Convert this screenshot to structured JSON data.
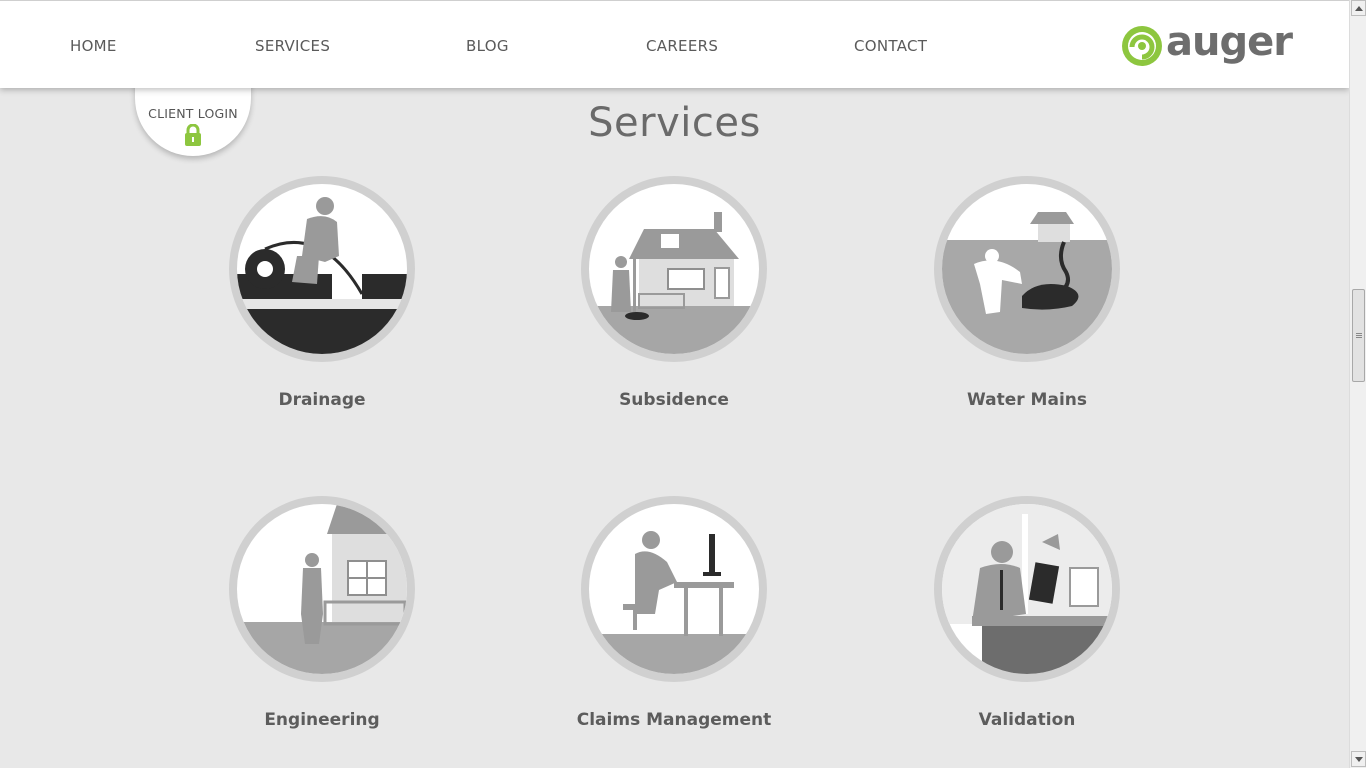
{
  "nav": {
    "items": [
      {
        "label": "HOME"
      },
      {
        "label": "SERVICES"
      },
      {
        "label": "BLOG"
      },
      {
        "label": "CAREERS"
      },
      {
        "label": "CONTACT"
      }
    ]
  },
  "logo": {
    "text": "auger",
    "color": "#8dc63f",
    "icon": "swirl-logo-icon"
  },
  "client_login": {
    "label": "CLIENT LOGIN",
    "icon": "lock-icon",
    "icon_color": "#8dc63f"
  },
  "page_title": "Services",
  "services": [
    {
      "label": "Drainage",
      "icon": "drainage-illustration"
    },
    {
      "label": "Subsidence",
      "icon": "subsidence-illustration"
    },
    {
      "label": "Water Mains",
      "icon": "water-mains-illustration"
    },
    {
      "label": "Engineering",
      "icon": "engineering-illustration"
    },
    {
      "label": "Claims Management",
      "icon": "claims-management-illustration"
    },
    {
      "label": "Validation",
      "icon": "validation-illustration"
    }
  ],
  "colors": {
    "background": "#e8e8e8",
    "accent": "#8dc63f",
    "text": "#5c5c5c"
  }
}
